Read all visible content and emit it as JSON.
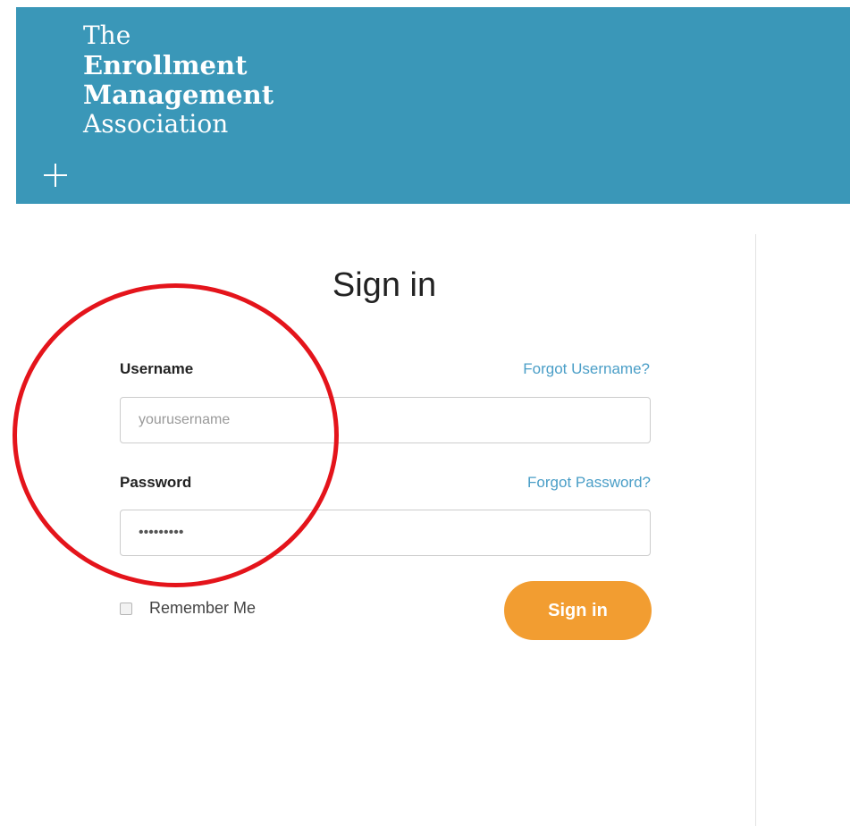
{
  "header": {
    "logo_lines": [
      "The",
      "Enrollment",
      "Management",
      "Association"
    ],
    "logo_icon": "plus-icon"
  },
  "form": {
    "title": "Sign in",
    "username": {
      "label": "Username",
      "forgot_link": "Forgot Username?",
      "value": "",
      "placeholder": "yourusername"
    },
    "password": {
      "label": "Password",
      "forgot_link": "Forgot Password?",
      "value": "*********"
    },
    "remember_label": "Remember Me",
    "remember_checked": false,
    "submit_label": "Sign in"
  },
  "colors": {
    "header_bg": "#3a97b8",
    "link": "#4a9ec7",
    "button_bg": "#f29d31",
    "annotation": "#e4141b"
  }
}
